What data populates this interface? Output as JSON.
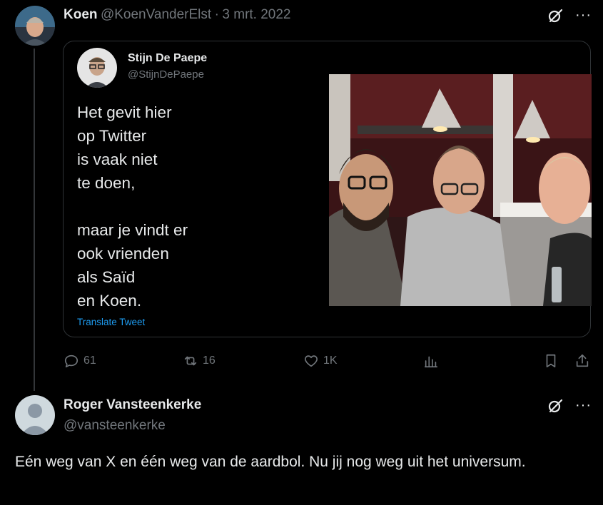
{
  "tweet": {
    "author_name": "Koen",
    "author_handle": "@KoenVanderElst",
    "separator": "·",
    "date": "3 mrt. 2022",
    "more_label": "···",
    "quote": {
      "author_name": "Stijn De Paepe",
      "author_handle": "@StijnDePaepe",
      "text": "Het gevit hier\nop Twitter\nis vaak niet\nte doen,\n\nmaar je vindt er\nook vrienden\nals Saïd\nen Koen.",
      "translate_label": "Translate Tweet"
    },
    "actions": {
      "replies": "61",
      "retweets": "16",
      "likes": "1K"
    }
  },
  "reply": {
    "author_name": "Roger Vansteenkerke",
    "author_handle": "@vansteenkerke",
    "more_label": "···",
    "text": "Eén weg van X en één weg van de aardbol. Nu jij nog weg uit het universum."
  },
  "icons": {
    "grok": "grok-icon",
    "reply": "reply-icon",
    "retweet": "retweet-icon",
    "like": "heart-icon",
    "views": "bar-chart-icon",
    "bookmark": "bookmark-icon",
    "share": "share-icon"
  }
}
